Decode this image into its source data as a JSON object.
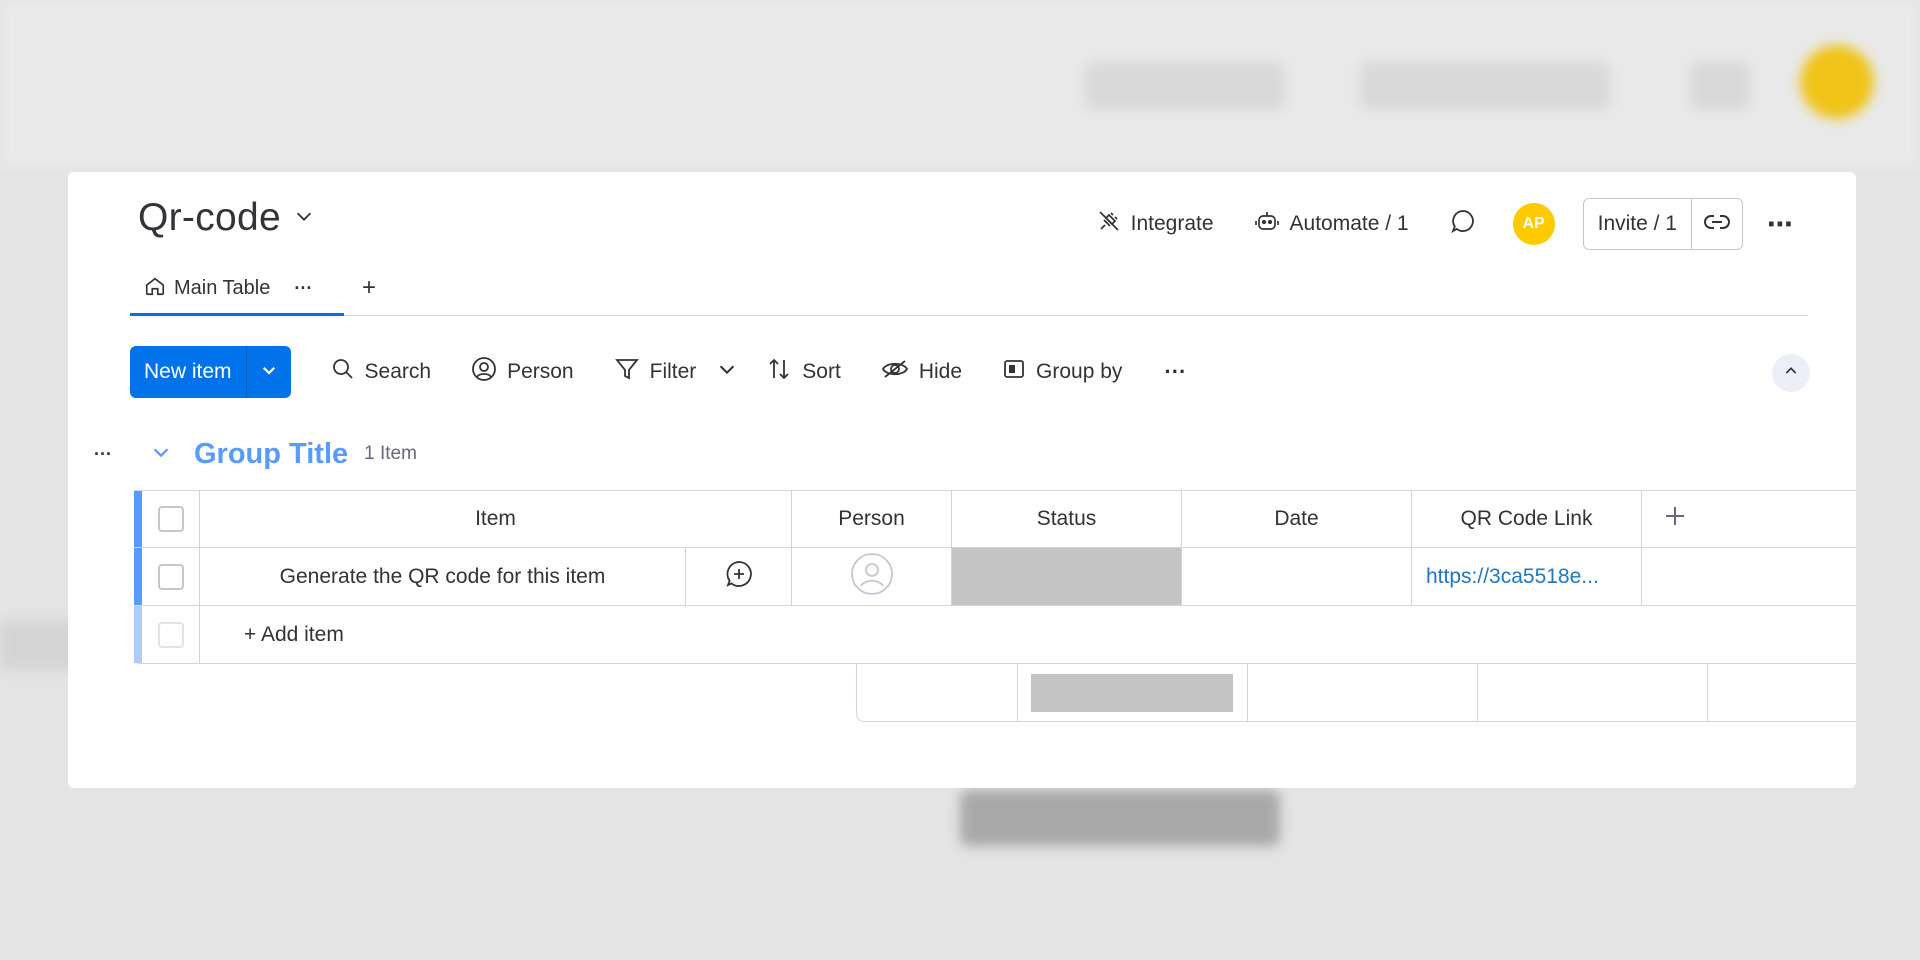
{
  "board": {
    "title": "Qr-code",
    "tabs": [
      {
        "label": "Main Table"
      }
    ],
    "add_tab_label": "+"
  },
  "header": {
    "integrate_label": "Integrate",
    "automate_label": "Automate / 1",
    "avatar_initials": "AP",
    "invite_label": "Invite / 1"
  },
  "toolbar": {
    "new_item_label": "New item",
    "search_label": "Search",
    "person_label": "Person",
    "filter_label": "Filter",
    "sort_label": "Sort",
    "hide_label": "Hide",
    "group_by_label": "Group by"
  },
  "group": {
    "title": "Group Title",
    "count_label": "1 Item",
    "color": "#579bfc"
  },
  "table": {
    "columns": [
      "Item",
      "Person",
      "Status",
      "Date",
      "QR Code Link"
    ],
    "rows": [
      {
        "item": "Generate the QR code for this item",
        "person": "",
        "status": "",
        "date": "",
        "qr_code_link": "https://3ca5518e..."
      }
    ],
    "add_item_label": "+ Add item"
  },
  "colors": {
    "accent": "#0073ea",
    "avatar": "#ffcb00",
    "status_empty": "#c4c4c4"
  }
}
